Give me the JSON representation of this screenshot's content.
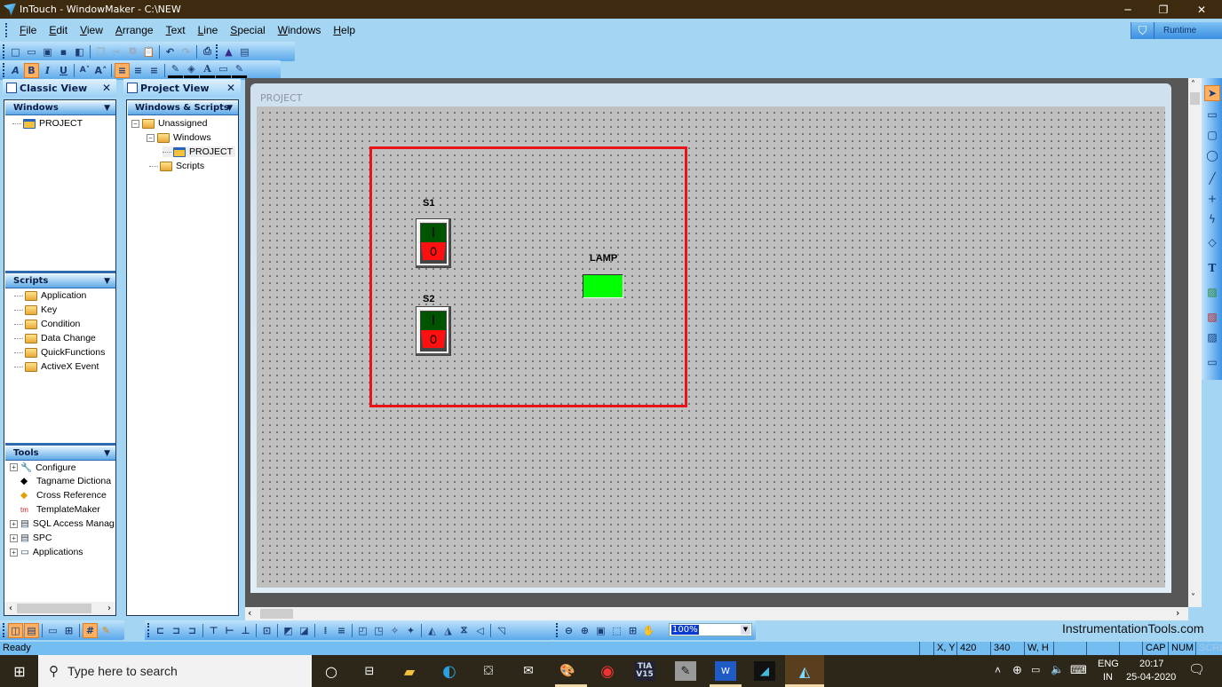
{
  "window": {
    "title": "InTouch - WindowMaker - C:\\NEW",
    "controls": {
      "minimize": "─",
      "maximize": "❐",
      "close": "✕"
    }
  },
  "menu": [
    {
      "label": "File",
      "accel": "F",
      "rest": "ile"
    },
    {
      "label": "Edit",
      "accel": "E",
      "rest": "dit"
    },
    {
      "label": "View",
      "accel": "V",
      "rest": "iew"
    },
    {
      "label": "Arrange",
      "accel": "A",
      "rest": "rrange"
    },
    {
      "label": "Text",
      "accel": "T",
      "rest": "ext"
    },
    {
      "label": "Line",
      "accel": "L",
      "rest": "ine"
    },
    {
      "label": "Special",
      "accel": "S",
      "rest": "pecial"
    },
    {
      "label": "Windows",
      "accel": "W",
      "rest": "indows"
    },
    {
      "label": "Help",
      "accel": "H",
      "rest": "elp"
    }
  ],
  "runtime_button": {
    "label": "Runtime",
    "icon": "runtime-icon"
  },
  "toolbar_standard": [
    "new-window-icon",
    "open-window-icon",
    "close-window-icon",
    "save-icon",
    "save-all-icon",
    "duplicate-icon",
    "cut-icon",
    "copy-icon",
    "paste-icon",
    "undo-icon",
    "redo-icon",
    "print-icon",
    "wizard-icon",
    "window-properties-icon"
  ],
  "toolbar_format": {
    "bold": "B",
    "italic": "I",
    "underline": "U",
    "items": [
      "font-icon",
      "bold-icon",
      "italic-icon",
      "underline-icon",
      "font-smaller-icon",
      "font-larger-icon",
      "align-left-icon",
      "align-center-icon",
      "align-right-icon",
      "line-color-icon",
      "fill-color-icon",
      "text-color-icon",
      "window-color-icon",
      "line-style-icon"
    ]
  },
  "classic_view": {
    "title": "Classic View",
    "windows": {
      "header": "Windows",
      "items": [
        "PROJECT"
      ]
    },
    "scripts": {
      "header": "Scripts",
      "items": [
        "Application",
        "Key",
        "Condition",
        "Data Change",
        "QuickFunctions",
        "ActiveX Event"
      ]
    },
    "tools": {
      "header": "Tools",
      "items": [
        {
          "label": "Configure",
          "expandable": true
        },
        {
          "label": "Tagname Dictiona",
          "expandable": false
        },
        {
          "label": "Cross Reference",
          "expandable": false
        },
        {
          "label": "TemplateMaker",
          "expandable": false
        },
        {
          "label": "SQL Access Manag",
          "expandable": true
        },
        {
          "label": "SPC",
          "expandable": true
        },
        {
          "label": "Applications",
          "expandable": true
        }
      ]
    }
  },
  "project_view": {
    "title": "Project View",
    "header": "Windows & Scripts",
    "tree": {
      "root": "Unassigned",
      "windows": "Windows",
      "window_item": "PROJECT",
      "scripts": "Scripts"
    }
  },
  "child_window": {
    "title": "PROJECT",
    "objects": {
      "s1_label": "S1",
      "s2_label": "S2",
      "switch_on": "I",
      "switch_off": "0",
      "lamp_label": "LAMP",
      "lamp_color": "#00ff00",
      "selection_color": "#e8141c"
    }
  },
  "draw_tools": [
    "select-pointer-icon",
    "rectangle-icon",
    "rounded-rectangle-icon",
    "ellipse-icon",
    "line-icon",
    "hv-line-icon",
    "polyline-icon",
    "polygon-icon",
    "text-icon",
    "bitmap-icon",
    "real-time-trend-icon",
    "historical-trend-icon",
    "button-icon"
  ],
  "bottom_toolbar": {
    "zoom_value": "100%"
  },
  "watermark": "InstrumentationTools.com",
  "status": {
    "ready": "Ready",
    "xy_label": "X, Y",
    "x": "420",
    "y": "340",
    "wh_label": "W, H",
    "cap": "CAP",
    "num": "NUM",
    "scrl": "SCRL"
  },
  "taskbar": {
    "search_placeholder": "Type here to search",
    "apps": [
      "cortana-icon",
      "task-view-icon",
      "file-explorer-icon",
      "edge-icon",
      "store-icon",
      "mail-icon",
      "paint-icon",
      "chrome-icon",
      "tia-portal-icon",
      "app-icon",
      "word-icon",
      "intouch-app-icon",
      "windowmaker-icon"
    ],
    "tia_label": "TIA V15",
    "lang1": "ENG",
    "lang2": "IN",
    "time": "20:17",
    "date": "25-04-2020"
  }
}
